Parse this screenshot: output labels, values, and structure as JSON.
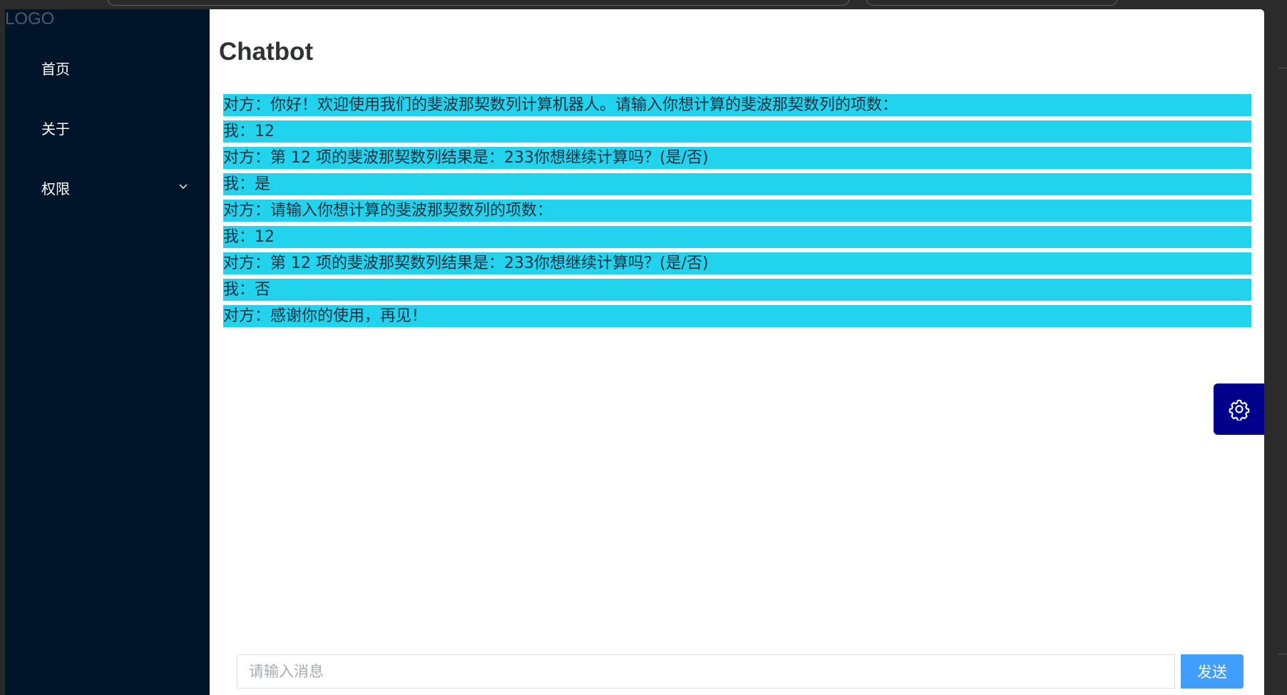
{
  "sidebar": {
    "logo": "LOGO",
    "items": [
      {
        "label": "首页"
      },
      {
        "label": "关于"
      },
      {
        "label": "权限"
      }
    ]
  },
  "page": {
    "title": "Chatbot"
  },
  "messages": [
    "对方：你好！欢迎使用我们的斐波那契数列计算机器人。请输入你想计算的斐波那契数列的项数：",
    "我：12",
    "对方：第 12 项的斐波那契数列结果是：233你想继续计算吗？(是/否)",
    "我：是",
    "对方：请输入你想计算的斐波那契数列的项数：",
    "我：12",
    "对方：第 12 项的斐波那契数列结果是：233你想继续计算吗？(是/否)",
    "我：否",
    "对方：感谢你的使用，再见！"
  ],
  "input": {
    "placeholder": "请输入消息",
    "value": ""
  },
  "send_label": "发送",
  "colors": {
    "sidebar_bg": "#001529",
    "message_bg": "#22d3ee",
    "settings_bg": "#00008b",
    "send_bg": "#409eff"
  },
  "icons": {
    "settings": "gear-icon",
    "submenu": "chevron-down-icon"
  }
}
